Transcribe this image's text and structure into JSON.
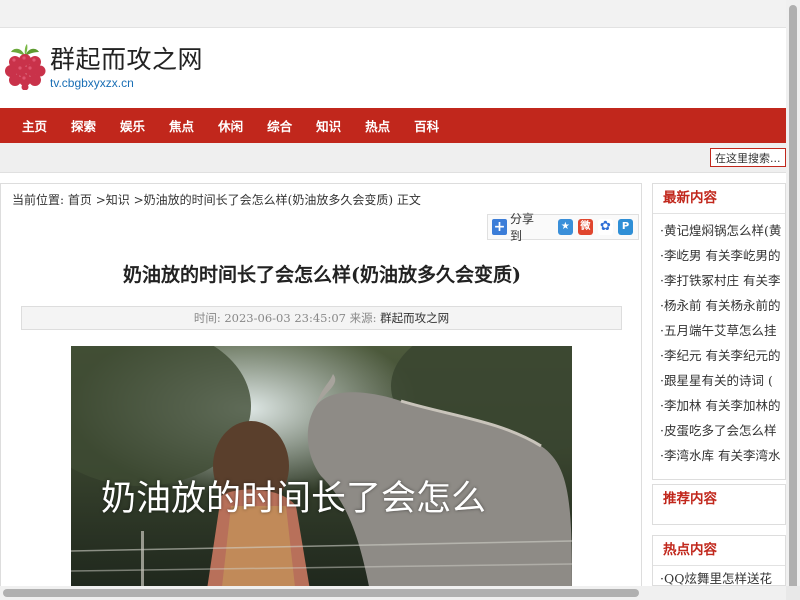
{
  "site": {
    "name": "群起而攻之网",
    "domain": "tv.cbgbxyxzx.cn"
  },
  "nav": {
    "items": [
      "主页",
      "探索",
      "娱乐",
      "焦点",
      "休闲",
      "综合",
      "知识",
      "热点",
      "百科"
    ]
  },
  "search": {
    "placeholder": "在这里搜索..."
  },
  "breadcrumb": {
    "prefix": "当前位置:",
    "home": "首页",
    "sep1": " >",
    "category": "知识",
    "sep2": " >",
    "current": "奶油放的时间长了会怎么样(奶油放多久会变质)",
    "suffix": " 正文"
  },
  "share": {
    "label": "分享到"
  },
  "article": {
    "title": "奶油放的时间长了会怎么样(奶油放多久会变质)",
    "meta_time_label": "时间:",
    "meta_time": "2023-06-03 23:45:07",
    "meta_source_label": "来源:",
    "meta_source": "群起而攻之网",
    "image_caption": "奶油放的时间长了会怎么"
  },
  "sidebar": {
    "latest": {
      "title": "最新内容",
      "items": [
        "·黄记煌焖锅怎么样(黄",
        "·李屹男 有关李屹男的",
        "·李打铁冢村庄 有关李",
        "·杨永前 有关杨永前的",
        "·五月端午艾草怎么挂",
        "·李纪元 有关李纪元的",
        "·跟星星有关的诗词 (",
        "·李加林 有关李加林的",
        "·皮蛋吃多了会怎么样",
        "·李湾水库 有关李湾水"
      ]
    },
    "recommended": {
      "title": "推荐内容"
    },
    "hot": {
      "title": "热点内容",
      "items": [
        "·QQ炫舞里怎样送花"
      ]
    }
  },
  "colors": {
    "brand_red": "#c1271c",
    "link_blue": "#1a6fb5"
  }
}
